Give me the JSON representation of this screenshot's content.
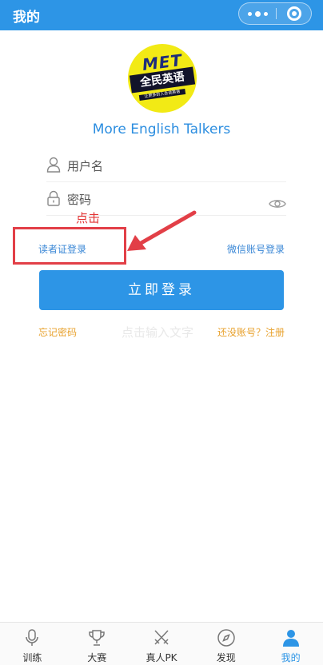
{
  "titlebar": {
    "title": "我的"
  },
  "logo": {
    "met": "MET",
    "banner": "全民英语",
    "sub": "让更多的人会说英语"
  },
  "app_name": "More English Talkers",
  "form": {
    "username_label": "用户名",
    "password_label": "密码"
  },
  "annotation": {
    "text": "点击"
  },
  "links": {
    "reader_card_login": "读者证登录",
    "wechat_login": "微信账号登录",
    "forgot_password": "忘记密码",
    "register": "还没账号？注册"
  },
  "login_button": "立即登录",
  "watermark": "点击输入文字",
  "tabs": [
    {
      "label": "训练",
      "icon": "microphone-icon"
    },
    {
      "label": "大赛",
      "icon": "trophy-icon"
    },
    {
      "label": "真人PK",
      "icon": "crossed-swords-icon"
    },
    {
      "label": "发现",
      "icon": "compass-icon"
    },
    {
      "label": "我的",
      "icon": "person-icon"
    }
  ],
  "colors": {
    "primary": "#2d95e6",
    "accent": "#e8a12c",
    "annotation": "#e23f47"
  }
}
